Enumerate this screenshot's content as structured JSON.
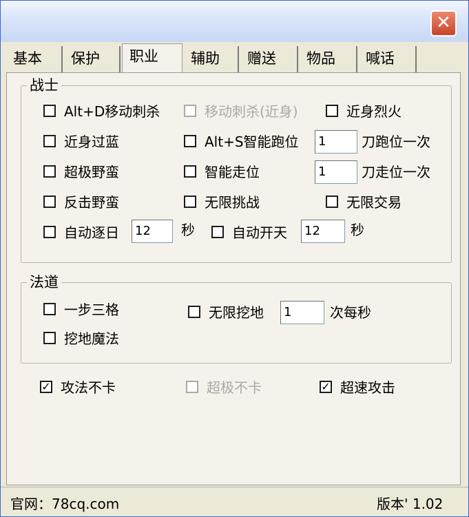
{
  "window": {
    "close_glyph": "✕"
  },
  "tabs": [
    {
      "label": "基本"
    },
    {
      "label": "保护"
    },
    {
      "label": "职业",
      "active": true
    },
    {
      "label": "辅助"
    },
    {
      "label": "赠送"
    },
    {
      "label": "物品"
    },
    {
      "label": "喊话"
    }
  ],
  "warrior": {
    "title": "战士",
    "options": {
      "alt_d_move_stab": {
        "label": "Alt+D移动刺杀",
        "checked": false
      },
      "move_stab_melee": {
        "label": "移动刺杀(近身)",
        "checked": false,
        "disabled": true
      },
      "melee_fire": {
        "label": "近身烈火",
        "checked": false
      },
      "melee_overblue": {
        "label": "近身过蓝",
        "checked": false
      },
      "alt_s_smart_run": {
        "label": "Alt+S智能跑位",
        "checked": false
      },
      "super_brute": {
        "label": "超极野蛮",
        "checked": false
      },
      "smart_walk": {
        "label": "智能走位",
        "checked": false
      },
      "counter_brute": {
        "label": "反击野蛮",
        "checked": false
      },
      "unlimited_challenge": {
        "label": "无限挑战",
        "checked": false
      },
      "unlimited_trade": {
        "label": "无限交易",
        "checked": false
      },
      "auto_sun": {
        "label": "自动逐日",
        "checked": false
      },
      "auto_open_sky": {
        "label": "自动开天",
        "checked": false
      }
    },
    "run_value": "1",
    "run_unit": "刀跑位一次",
    "walk_value": "1",
    "walk_unit": "刀走位一次",
    "sun_value": "12",
    "sun_unit": "秒",
    "sky_value": "12",
    "sky_unit": "秒"
  },
  "mage": {
    "title": "法道",
    "options": {
      "one_step_three": {
        "label": "一步三格",
        "checked": false
      },
      "unlimited_dig": {
        "label": "无限挖地",
        "checked": false
      },
      "dig_magic": {
        "label": "挖地魔法",
        "checked": false
      }
    },
    "dig_value": "1",
    "dig_unit": "次每秒"
  },
  "bottom": {
    "attack_no_lag": {
      "label": "攻法不卡",
      "checked": true
    },
    "super_no_lag": {
      "label": "超极不卡",
      "checked": false,
      "disabled": true
    },
    "speed_attack": {
      "label": "超速攻击",
      "checked": true
    }
  },
  "status": {
    "website": "官网：78cq.com",
    "version": "版本' 1.02"
  }
}
